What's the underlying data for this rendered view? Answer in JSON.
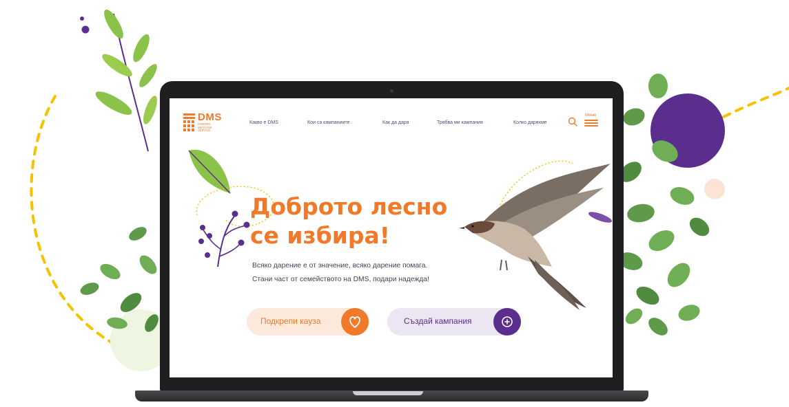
{
  "colors": {
    "brand_orange": "#f07a2a",
    "brand_purple": "#5b2d8c",
    "leaf_green": "#8bc34a",
    "dot_yellow": "#f5c200"
  },
  "logo": {
    "name": "DMS",
    "subtitle": "DONORS MESSAGE SERVICE"
  },
  "nav": {
    "items": [
      {
        "label": "Какво е DMS"
      },
      {
        "label": "Кои са кампаниите"
      },
      {
        "label": "Как да даря"
      },
      {
        "label": "Трябва ми кампания"
      },
      {
        "label": "Колко даряхме"
      }
    ],
    "menu_label": "Меню",
    "search_icon": "search-icon",
    "menu_icon": "hamburger-icon"
  },
  "hero": {
    "title_line1": "Доброто лесно",
    "title_line2": "се избира!",
    "subtitle_line1": "Всяко дарение е от значение, всяко дарение помага.",
    "subtitle_line2": "Стани част от семейството на DMS, подари надежда!"
  },
  "actions": {
    "support_label": "Подкрепи кауза",
    "support_icon": "heart-icon",
    "create_label": "Създай кампания",
    "create_icon": "plus-circle-icon"
  }
}
